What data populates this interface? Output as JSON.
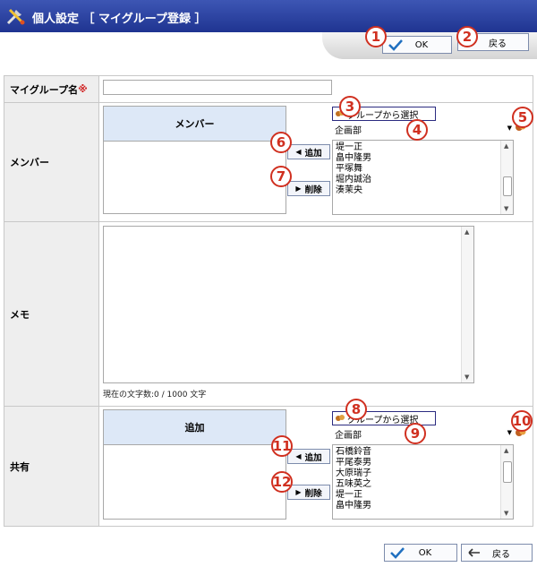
{
  "header": {
    "title": "個人設定 ［ マイグループ登録 ］"
  },
  "toolbar": {
    "ok_label": "OK",
    "back_label": "戻る"
  },
  "markers": [
    "1",
    "2",
    "3",
    "4",
    "5",
    "6",
    "7",
    "8",
    "9",
    "10",
    "11",
    "12"
  ],
  "form": {
    "group_name": {
      "label": "マイグループ名",
      "required_mark": "※",
      "value": ""
    },
    "member": {
      "label": "メンバー",
      "panel_title": "メンバー",
      "add_label": "追加",
      "delete_label": "削除",
      "group_select_label": "グループから選択",
      "department": "企画部",
      "candidates": [
        "堤一正",
        "畠中隆男",
        "平塚舞",
        "堀内誠治",
        "湊茉央"
      ]
    },
    "memo": {
      "label": "メモ",
      "value": "",
      "counter": "現在の文字数:0 / 1000 文字"
    },
    "share": {
      "label": "共有",
      "panel_title": "追加",
      "add_label": "追加",
      "delete_label": "削除",
      "group_select_label": "グループから選択",
      "department": "企画部",
      "candidates": [
        "石橋鈴音",
        "平尾泰男",
        "大原瑞子",
        "五味英之",
        "堤一正",
        "畠中隆男"
      ]
    }
  },
  "footer": {
    "ok_label": "OK",
    "back_label": "戻る"
  },
  "colors": {
    "title_bar": "#2a3f9f",
    "marker": "#d03020",
    "label_bg": "#eeeeee",
    "panel_header": "#dde8f7"
  }
}
